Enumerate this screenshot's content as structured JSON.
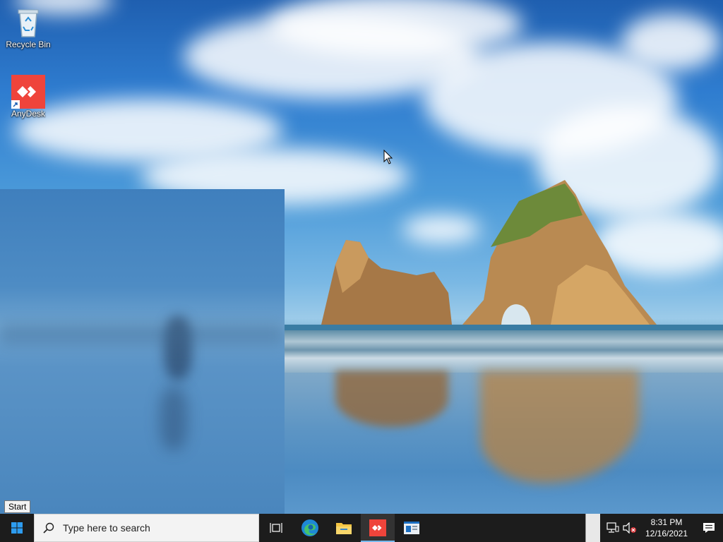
{
  "desktop": {
    "icons": [
      {
        "label": "Recycle Bin",
        "icon": "recycle-bin-icon"
      },
      {
        "label": "AnyDesk",
        "icon": "anydesk-icon"
      }
    ]
  },
  "tooltip": {
    "text": "Start"
  },
  "taskbar": {
    "start_icon": "windows-logo-icon",
    "search": {
      "placeholder": "Type here to search",
      "icon": "search-icon"
    },
    "pinned": [
      {
        "name": "Task View",
        "icon": "task-view-icon"
      },
      {
        "name": "Microsoft Edge",
        "icon": "edge-icon"
      },
      {
        "name": "File Explorer",
        "icon": "folder-icon"
      },
      {
        "name": "AnyDesk",
        "icon": "anydesk-icon",
        "active": true
      },
      {
        "name": "Application",
        "icon": "window-app-icon"
      }
    ],
    "tray": {
      "network_icon": "network-icon",
      "volume_icon": "volume-muted-icon",
      "time": "8:31 PM",
      "date": "12/16/2021",
      "notification_icon": "action-center-icon"
    }
  },
  "colors": {
    "anydesk_red": "#ef443b",
    "taskbar_bg": "#1c1c1c",
    "accent": "#0078d7"
  }
}
